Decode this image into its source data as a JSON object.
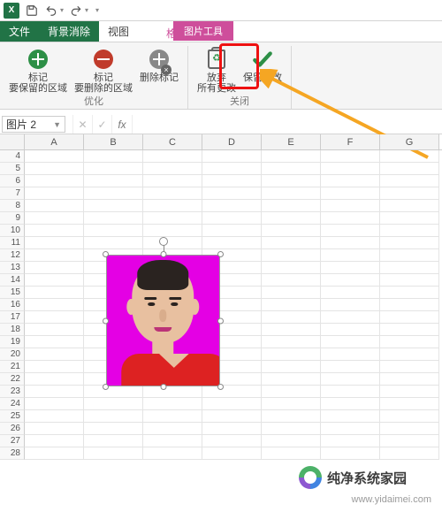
{
  "qat": {
    "app_icon_letter": "X"
  },
  "tabs": {
    "file": "文件",
    "bg_remove": "背景消除",
    "view": "视图",
    "context_title": "图片工具",
    "context_sub": "格式"
  },
  "ribbon": {
    "mark_keep": "标记\n要保留的区域",
    "mark_remove": "标记\n要删除的区域",
    "delete_marks": "删除标记",
    "group_optimize": "优化",
    "discard": "放弃\n所有更改",
    "keep_changes": "保留更改",
    "group_close": "关闭"
  },
  "formula_bar": {
    "namebox": "图片 2",
    "fx": "fx",
    "value": ""
  },
  "grid": {
    "cols": [
      "A",
      "B",
      "C",
      "D",
      "E",
      "F",
      "G"
    ],
    "row_start": 4,
    "row_end": 28
  },
  "watermark": {
    "brand": "纯净系统家园",
    "url": "www.yidaimei.com"
  }
}
